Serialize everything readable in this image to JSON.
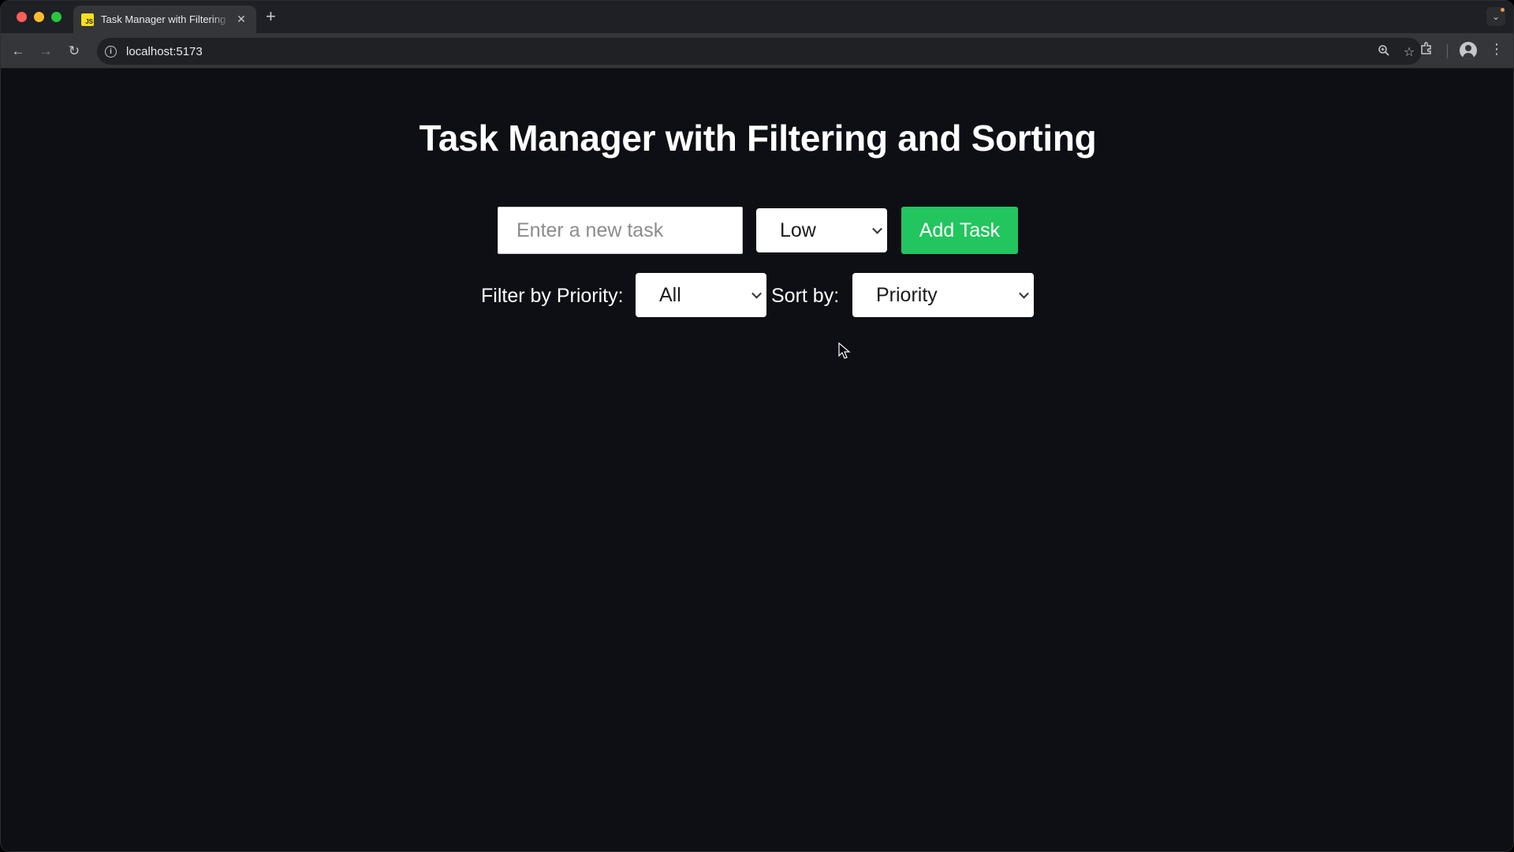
{
  "browser": {
    "tab_title": "Task Manager with Filtering and Sorting",
    "tab_favicon_text": "JS",
    "url": "localhost:5173",
    "icons": [
      "back-icon",
      "forward-icon",
      "reload-icon",
      "info-icon",
      "zoom-icon",
      "bookmark-star-icon",
      "extensions-icon",
      "profile-icon",
      "menu-icon",
      "tab-search-icon",
      "close-icon",
      "plus-icon"
    ]
  },
  "page": {
    "title": "Task Manager with Filtering and Sorting",
    "task_input": {
      "placeholder": "Enter a new task",
      "value": ""
    },
    "priority_select": {
      "selected": "Low"
    },
    "add_button_label": "Add Task",
    "filter_label": "Filter by Priority:",
    "filter_select": {
      "selected": "All"
    },
    "sort_label": "Sort by:",
    "sort_select": {
      "selected": "Priority"
    },
    "colors": {
      "background": "#0d0f14",
      "add_button": "#22c55e",
      "text": "#ffffff"
    }
  }
}
